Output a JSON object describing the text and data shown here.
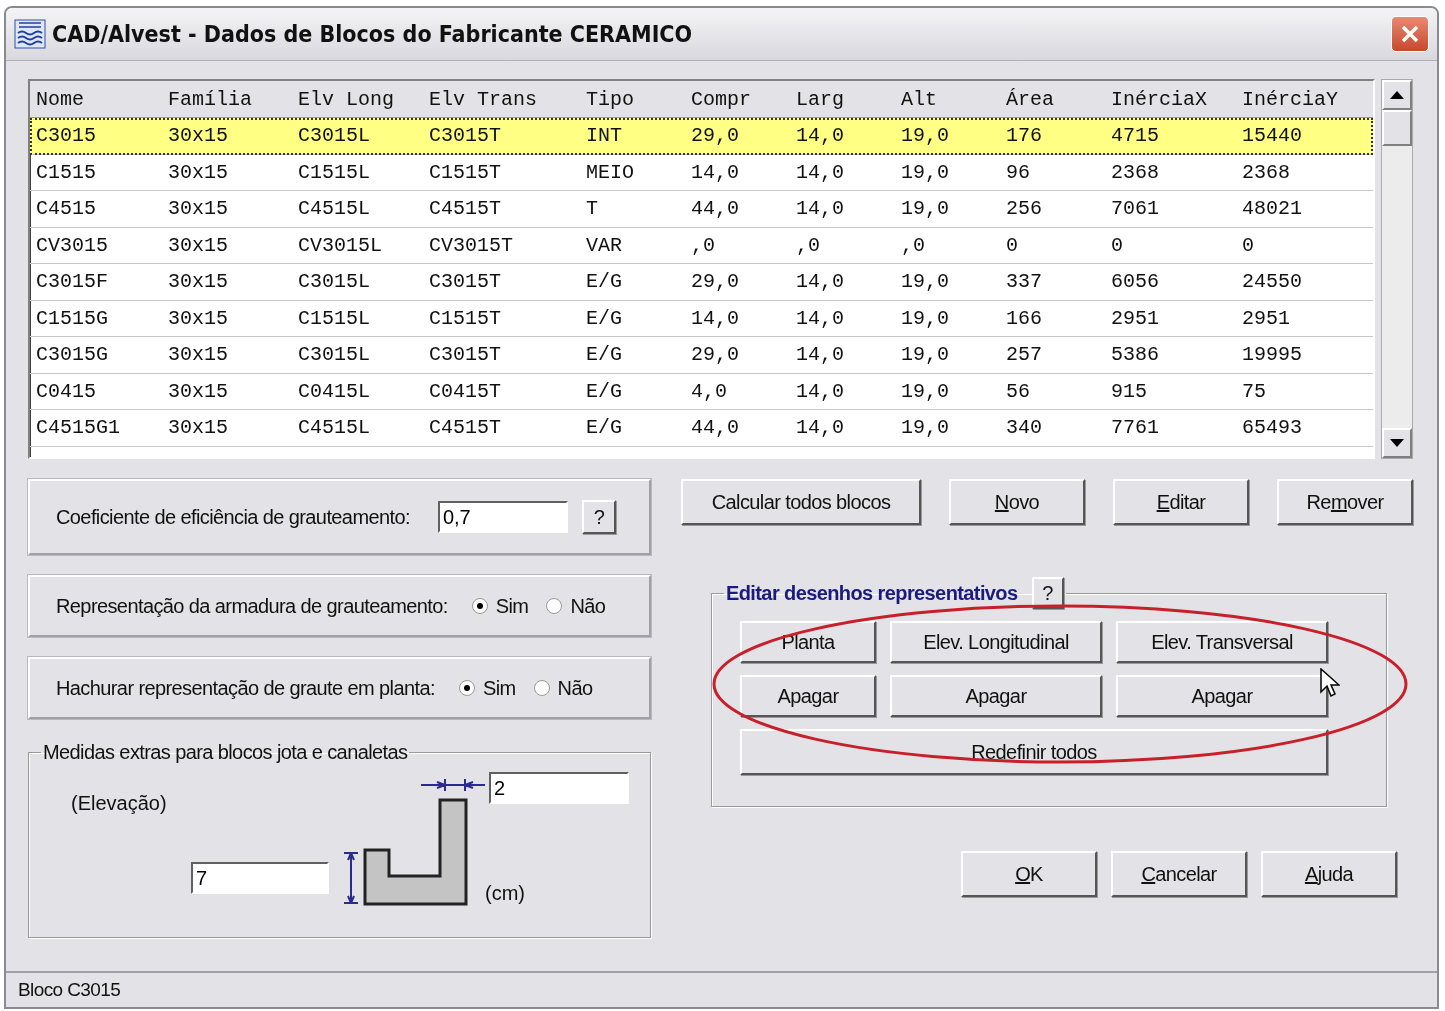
{
  "window": {
    "title": "CAD/Alvest - Dados de Blocos do Fabricante  CERAMICO"
  },
  "table": {
    "columns": [
      "Nome",
      "Família",
      "Elv Long",
      "Elv Trans",
      "Tipo",
      "Compr",
      "Larg",
      "Alt",
      "Área",
      "InérciaX",
      "InérciaY"
    ],
    "rows": [
      {
        "selected": true,
        "cells": [
          "C3015",
          "30x15",
          "C3015L",
          "C3015T",
          "INT",
          "29,0",
          "14,0",
          "19,0",
          "176",
          "4715",
          "15440"
        ]
      },
      {
        "selected": false,
        "cells": [
          "C1515",
          "30x15",
          "C1515L",
          "C1515T",
          "MEIO",
          "14,0",
          "14,0",
          "19,0",
          "96",
          "2368",
          "2368"
        ]
      },
      {
        "selected": false,
        "cells": [
          "C4515",
          "30x15",
          "C4515L",
          "C4515T",
          "T",
          "44,0",
          "14,0",
          "19,0",
          "256",
          "7061",
          "48021"
        ]
      },
      {
        "selected": false,
        "cells": [
          "CV3015",
          "30x15",
          "CV3015L",
          "CV3015T",
          "VAR",
          ",0",
          ",0",
          ",0",
          "0",
          "0",
          "0"
        ]
      },
      {
        "selected": false,
        "cells": [
          "C3015F",
          "30x15",
          "C3015L",
          "C3015T",
          "E/G",
          "29,0",
          "14,0",
          "19,0",
          "337",
          "6056",
          "24550"
        ]
      },
      {
        "selected": false,
        "cells": [
          "C1515G",
          "30x15",
          "C1515L",
          "C1515T",
          "E/G",
          "14,0",
          "14,0",
          "19,0",
          "166",
          "2951",
          "2951"
        ]
      },
      {
        "selected": false,
        "cells": [
          "C3015G",
          "30x15",
          "C3015L",
          "C3015T",
          "E/G",
          "29,0",
          "14,0",
          "19,0",
          "257",
          "5386",
          "19995"
        ]
      },
      {
        "selected": false,
        "cells": [
          "C0415",
          "30x15",
          "C0415L",
          "C0415T",
          "E/G",
          "4,0",
          "14,0",
          "19,0",
          "56",
          "915",
          "75"
        ]
      },
      {
        "selected": false,
        "cells": [
          "C4515G1",
          "30x15",
          "C4515L",
          "C4515T",
          "E/G",
          "44,0",
          "14,0",
          "19,0",
          "340",
          "7761",
          "65493"
        ]
      }
    ]
  },
  "efficiency": {
    "label": "Coeficiente de eficiência de grauteamento:",
    "value": "0,7",
    "help": "?"
  },
  "options": [
    {
      "label": "Representação da armadura de grauteamento:",
      "choices": [
        {
          "label": "Sim",
          "selected": true
        },
        {
          "label": "Não",
          "selected": false
        }
      ]
    },
    {
      "label": "Hachurar representação de graute em planta:",
      "choices": [
        {
          "label": "Sim",
          "selected": true
        },
        {
          "label": "Não",
          "selected": false
        }
      ]
    }
  ],
  "extras": {
    "title": "Medidas extras para blocos jota e canaletas",
    "view": "(Elevação)",
    "width_value": "2",
    "height_value": "7",
    "unit": "(cm)"
  },
  "actions": [
    {
      "label": [
        {
          "text": "Calcular todos blocos",
          "underline": false
        }
      ]
    },
    {
      "label": [
        {
          "text": "N",
          "underline": true
        },
        {
          "text": "ovo",
          "underline": false
        }
      ]
    },
    {
      "label": [
        {
          "text": "E",
          "underline": true
        },
        {
          "text": "ditar",
          "underline": false
        }
      ]
    },
    {
      "label": [
        {
          "text": "Re",
          "underline": false
        },
        {
          "text": "m",
          "underline": true
        },
        {
          "text": "over",
          "underline": false
        }
      ]
    }
  ],
  "drawings": {
    "title": "Editar desenhos representativos",
    "help": "?",
    "views": [
      {
        "label": "Planta",
        "clear": "Apagar"
      },
      {
        "label": "Elev. Longitudinal",
        "clear": "Apagar"
      },
      {
        "label": "Elev. Transversal",
        "clear": "Apagar"
      }
    ],
    "reset": "Redefinir todos"
  },
  "dialog_buttons": [
    {
      "label": [
        {
          "text": "O",
          "underline": true
        },
        {
          "text": "K",
          "underline": false
        }
      ]
    },
    {
      "label": [
        {
          "text": "C",
          "underline": true
        },
        {
          "text": "ancelar",
          "underline": false
        }
      ]
    },
    {
      "label": [
        {
          "text": "A",
          "underline": true
        },
        {
          "text": "juda",
          "underline": false
        }
      ]
    }
  ],
  "status_bar": "Bloco C3015"
}
